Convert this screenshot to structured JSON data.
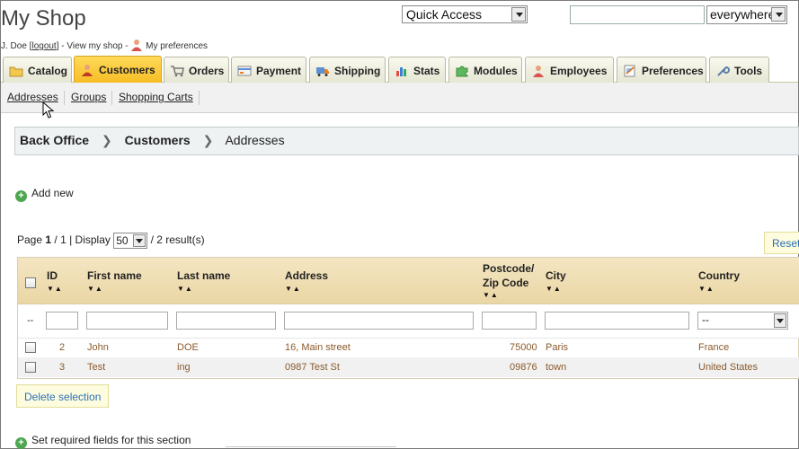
{
  "header": {
    "shop_title": "My Shop",
    "user_name": "J. Doe",
    "bracket_open": " [",
    "logout": "logout",
    "bracket_close_view": "] - View my shop -",
    "my_preferences": "My preferences",
    "quick_access": "Quick Access",
    "search_placeholder": "",
    "search_scope": "everywhere"
  },
  "tabs": [
    {
      "label": "Catalog",
      "icon": "folder-icon"
    },
    {
      "label": "Customers",
      "icon": "customer-icon",
      "active": true
    },
    {
      "label": "Orders",
      "icon": "cart-icon"
    },
    {
      "label": "Payment",
      "icon": "payment-icon"
    },
    {
      "label": "Shipping",
      "icon": "truck-icon"
    },
    {
      "label": "Stats",
      "icon": "chart-icon"
    },
    {
      "label": "Modules",
      "icon": "puzzle-icon"
    },
    {
      "label": "Employees",
      "icon": "employee-icon"
    },
    {
      "label": "Preferences",
      "icon": "preferences-icon"
    },
    {
      "label": "Tools",
      "icon": "wrench-icon"
    }
  ],
  "subtabs": [
    {
      "label": "Addresses"
    },
    {
      "label": "Groups"
    },
    {
      "label": "Shopping Carts"
    }
  ],
  "breadcrumb": {
    "root": "Back Office",
    "section": "Customers",
    "current": "Addresses"
  },
  "actions": {
    "add_new": "Add new",
    "reset": "Reset",
    "delete_selection": "Delete selection",
    "required_fields": "Set required fields for this section"
  },
  "pager": {
    "page_label": "Page",
    "page": "1",
    "of": "/ 1 | Display",
    "per_page": "50",
    "results": "/ 2 result(s)"
  },
  "table": {
    "columns": {
      "id": "ID",
      "first_name": "First name",
      "last_name": "Last name",
      "address": "Address",
      "postcode_1": "Postcode/",
      "postcode_2": "Zip Code",
      "city": "City",
      "country": "Country"
    },
    "filter_placeholder": "--",
    "country_filter": "--",
    "rows": [
      {
        "id": "2",
        "first_name": "John",
        "last_name": "DOE",
        "address": "16, Main street",
        "postcode": "75000",
        "city": "Paris",
        "country": "France"
      },
      {
        "id": "3",
        "first_name": "Test",
        "last_name": "ing",
        "address": "0987 Test St",
        "postcode": "09876",
        "city": "town",
        "country": "United States"
      }
    ]
  },
  "colors": {
    "active_tab": "#f6bd23",
    "table_header": "#ead6a4",
    "link_blue": "#2d6fb4",
    "row_text": "#8a5a2b"
  }
}
